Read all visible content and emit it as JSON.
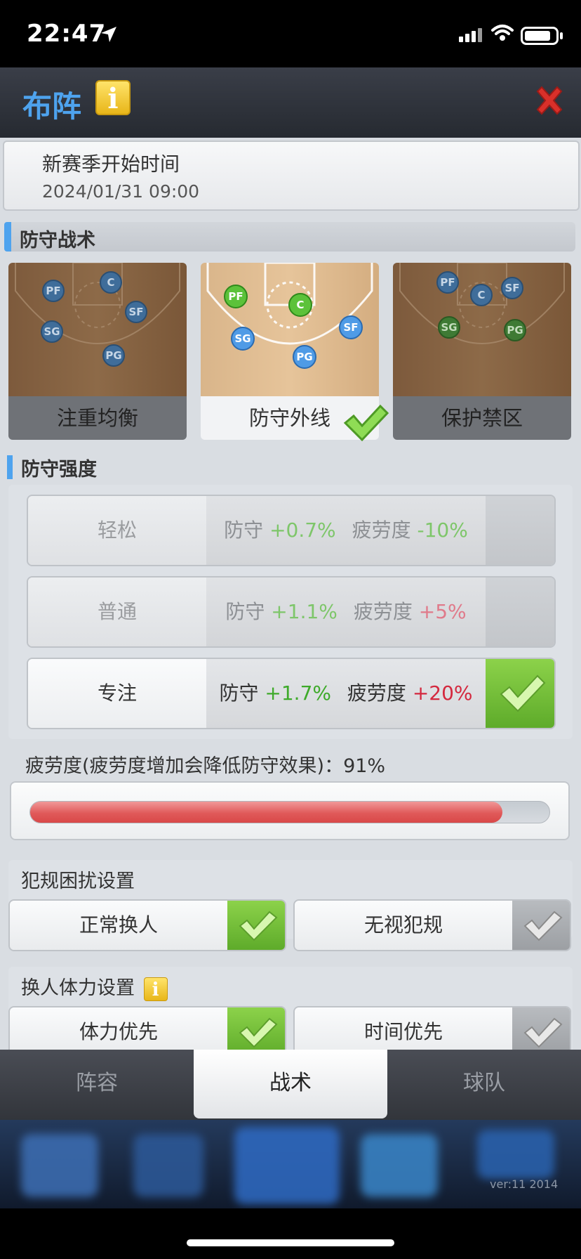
{
  "status_bar": {
    "time": "22:47"
  },
  "header": {
    "title": "布阵",
    "info_icon": "i"
  },
  "season": {
    "label": "新赛季开始时间",
    "datetime": "2024/01/31 09:00"
  },
  "defense_tactics": {
    "title": "防守战术",
    "options": [
      {
        "label": "注重均衡",
        "selected": false,
        "players": [
          "PF",
          "C",
          "SF",
          "SG",
          "PG"
        ]
      },
      {
        "label": "防守外线",
        "selected": true,
        "players": [
          "PF",
          "C",
          "SF",
          "SG",
          "PG"
        ]
      },
      {
        "label": "保护禁区",
        "selected": false,
        "players": [
          "PF",
          "C",
          "SF",
          "SG",
          "PG"
        ]
      }
    ]
  },
  "defense_intensity": {
    "title": "防守强度",
    "rows": [
      {
        "name": "轻松",
        "defense_label": "防守",
        "defense_value": "+0.7%",
        "fatigue_label": "疲劳度",
        "fatigue_value": "-10%",
        "selected": false
      },
      {
        "name": "普通",
        "defense_label": "防守",
        "defense_value": "+1.1%",
        "fatigue_label": "疲劳度",
        "fatigue_value": "+5%",
        "selected": false
      },
      {
        "name": "专注",
        "defense_label": "防守",
        "defense_value": "+1.7%",
        "fatigue_label": "疲劳度",
        "fatigue_value": "+20%",
        "selected": true
      }
    ],
    "fatigue_text": "疲劳度(疲劳度增加会降低防守效果)：91%",
    "fatigue_percent": 91
  },
  "foul_settings": {
    "title": "犯规困扰设置",
    "options": [
      {
        "label": "正常换人",
        "selected": true
      },
      {
        "label": "无视犯规",
        "selected": false
      }
    ]
  },
  "stamina_settings": {
    "title": "换人体力设置",
    "info_icon": "i",
    "options": [
      {
        "label": "体力优先",
        "selected": true
      },
      {
        "label": "时间优先",
        "selected": false
      }
    ]
  },
  "tabs": [
    {
      "label": "阵容",
      "active": false
    },
    {
      "label": "战术",
      "active": true
    },
    {
      "label": "球队",
      "active": false
    }
  ],
  "footer": {
    "version": "ver:11  2014"
  },
  "colors": {
    "accent_blue": "#4ea3ee",
    "check_green": "#6cc234",
    "fatigue_red": "#e05a5a"
  }
}
